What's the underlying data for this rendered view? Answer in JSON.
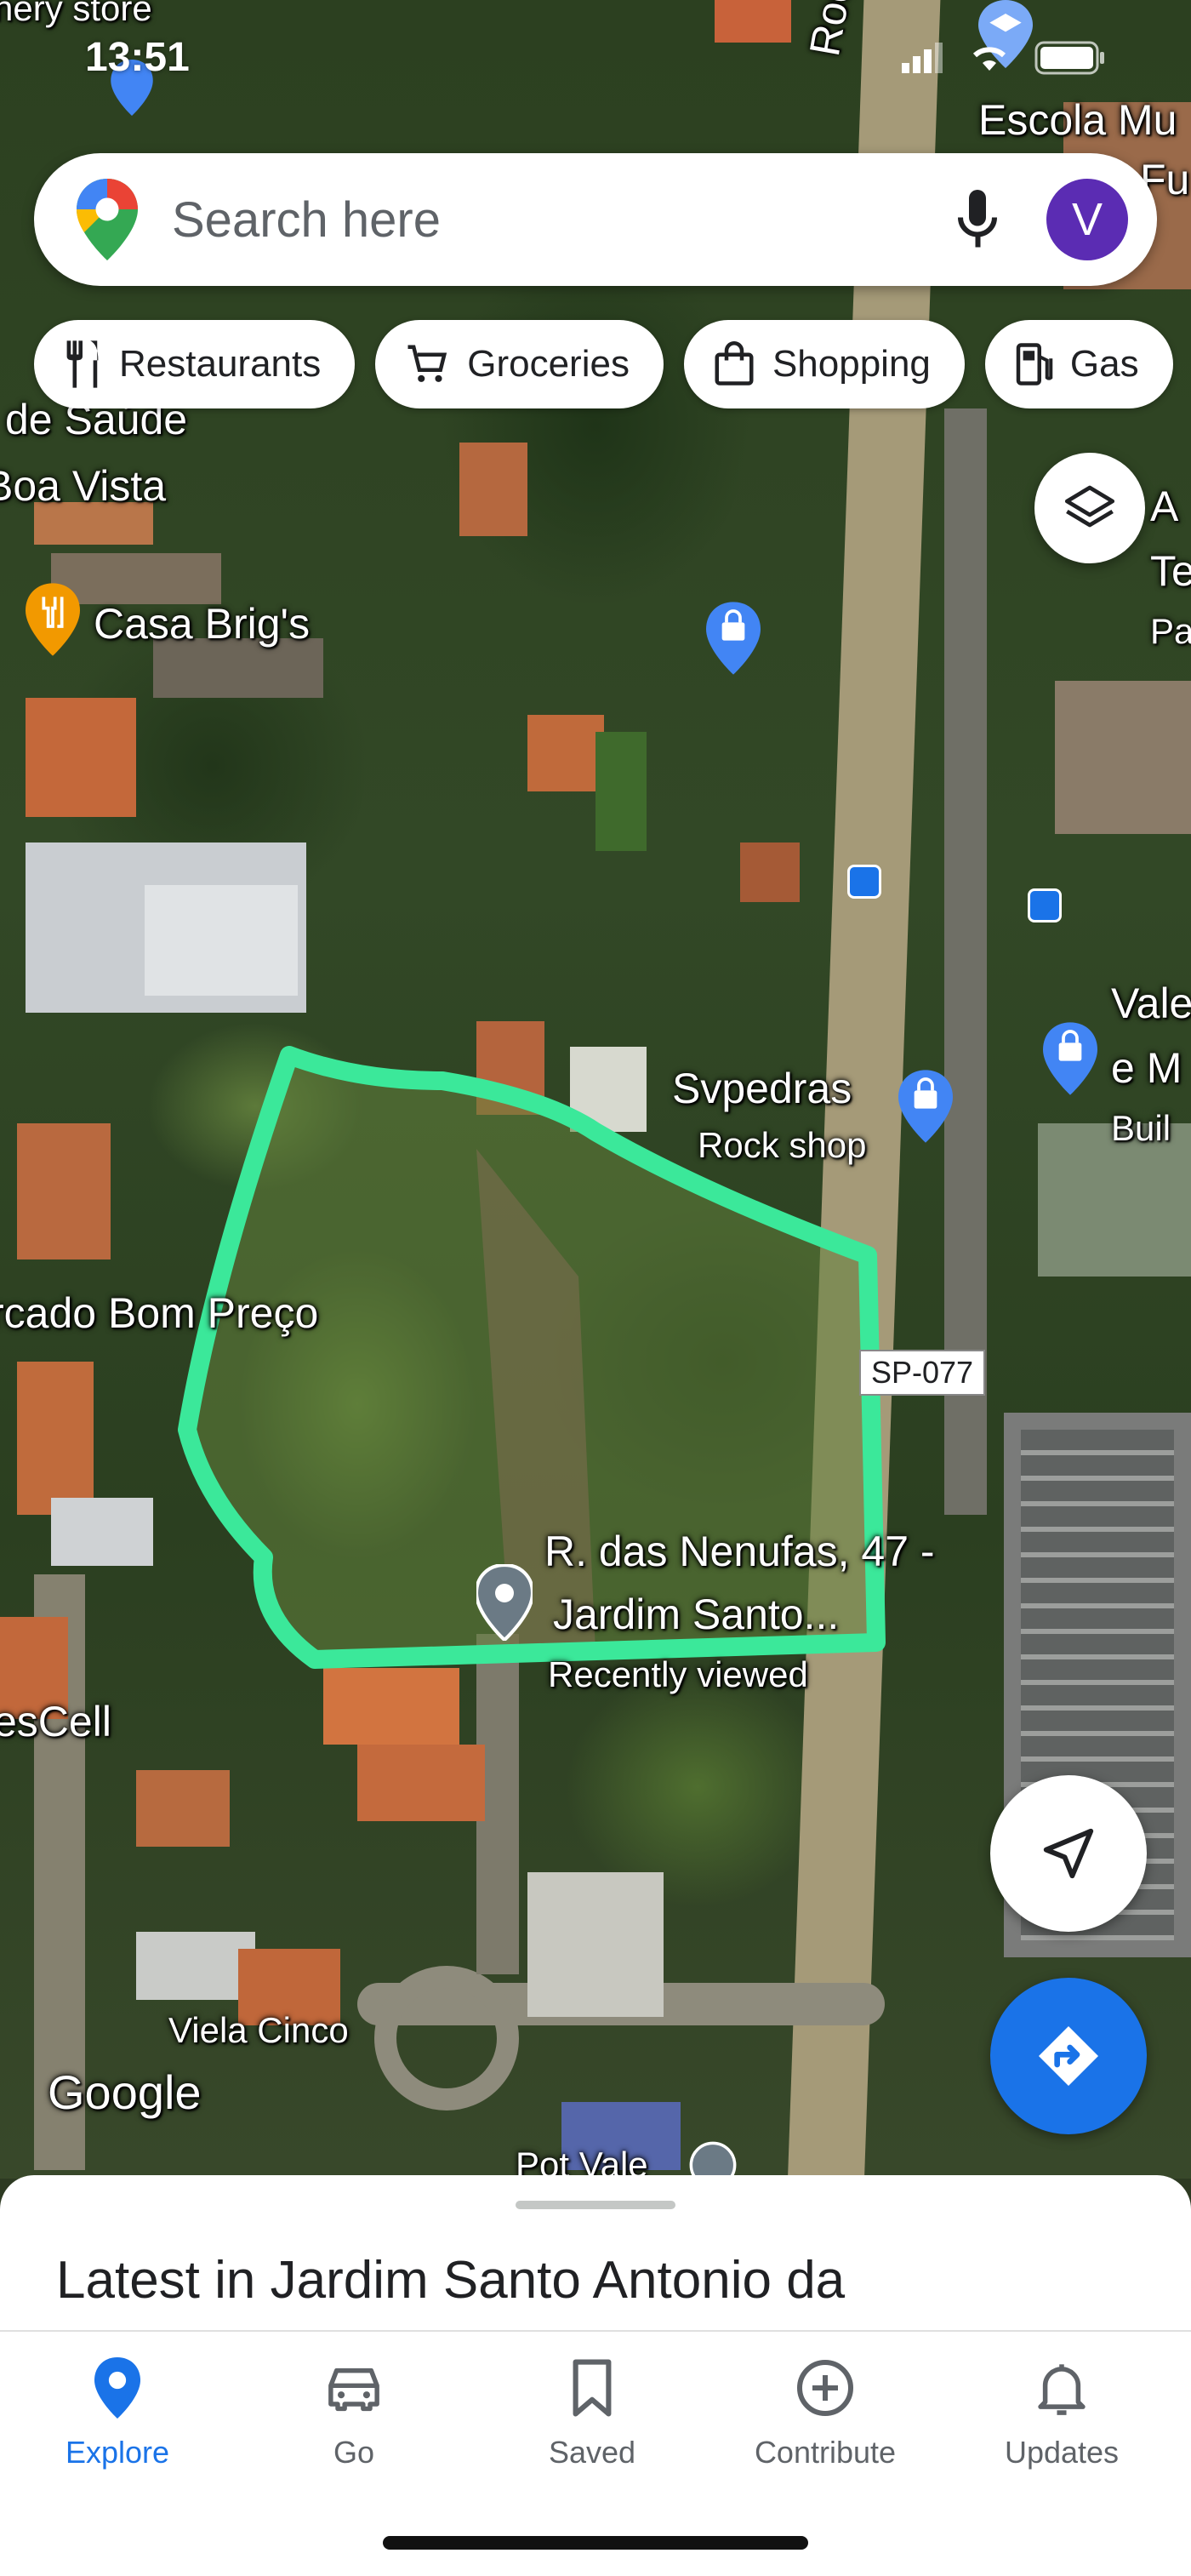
{
  "status_bar": {
    "time": "13:51"
  },
  "search": {
    "placeholder": "Search here",
    "avatar_letter": "V"
  },
  "chips": [
    {
      "label": "Restaurants",
      "icon": "fork-knife-icon"
    },
    {
      "label": "Groceries",
      "icon": "cart-icon"
    },
    {
      "label": "Shopping",
      "icon": "shopping-bag-icon"
    },
    {
      "label": "Gas",
      "icon": "gas-pump-icon"
    }
  ],
  "map_labels": {
    "store_top": "nery store",
    "escola": "Escola Mu",
    "escola2": "Fu",
    "road_vertical": "Rod.",
    "saude": "de Saúde",
    "boa_vista": "Boa Vista",
    "casa_brigs": "Casa Brig's",
    "right_a": "A",
    "right_te": "Te",
    "right_pa": "Pa",
    "svpedras": "Svpedras",
    "svpedras_sub": "Rock shop",
    "vale": "Vale",
    "em": "e M",
    "buil": "Buil",
    "mercado": "rcado Bom Preço",
    "road_sign": "SP-077",
    "address_line1": "R. das Nenufas, 47 -",
    "address_line2": "Jardim Santo...",
    "recently_viewed": "Recently viewed",
    "escell": "esCell",
    "viela": "Viela Cinco",
    "google": "Google",
    "pot_vale": "Pot Vale"
  },
  "sheet": {
    "title": "Latest in Jardim Santo Antonio da"
  },
  "bottom_nav": [
    {
      "label": "Explore",
      "active": true
    },
    {
      "label": "Go",
      "active": false
    },
    {
      "label": "Saved",
      "active": false
    },
    {
      "label": "Contribute",
      "active": false
    },
    {
      "label": "Updates",
      "active": false
    }
  ],
  "colors": {
    "accent": "#1a73e8",
    "outline": "#3be89a",
    "avatar": "#5b2cb3"
  }
}
